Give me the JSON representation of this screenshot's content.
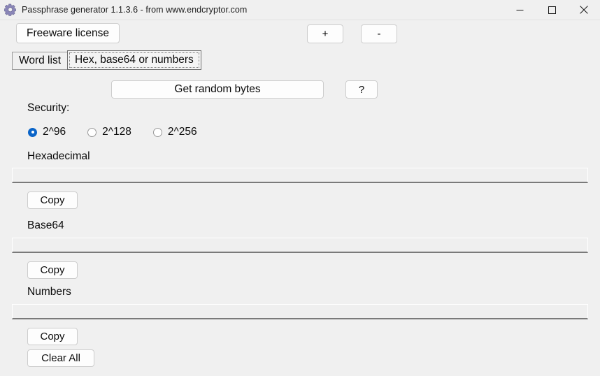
{
  "window": {
    "title": "Passphrase generator 1.1.3.6 - from www.endcryptor.com",
    "icon": "gear-icon",
    "controls": {
      "minimize": "minimize-icon",
      "maximize": "maximize-icon",
      "close": "close-icon"
    }
  },
  "toolbar": {
    "license_label": "Freeware license",
    "plus_label": "+",
    "minus_label": "-"
  },
  "tabs": [
    {
      "label": "Word list",
      "selected": false
    },
    {
      "label": "Hex, base64 or numbers",
      "selected": true
    }
  ],
  "actions": {
    "generate_label": "Get random bytes",
    "help_label": "?"
  },
  "security": {
    "label": "Security:",
    "options": [
      {
        "label": "2^96",
        "checked": true
      },
      {
        "label": "2^128",
        "checked": false
      },
      {
        "label": "2^256",
        "checked": false
      }
    ]
  },
  "outputs": [
    {
      "label": "Hexadecimal",
      "value": "",
      "placeholder": "",
      "copy_label": "Copy"
    },
    {
      "label": "Base64",
      "value": "",
      "placeholder": "",
      "copy_label": "Copy"
    },
    {
      "label": "Numbers",
      "value": "",
      "placeholder": "",
      "copy_label": "Copy"
    }
  ],
  "footer": {
    "clear_all_label": "Clear All"
  },
  "colors": {
    "background": "#f0f0f0",
    "accent": "#0a64c8",
    "button_face": "#fdfdfd",
    "field_face": "#efefef",
    "field_underline": "#7a7a7a"
  }
}
